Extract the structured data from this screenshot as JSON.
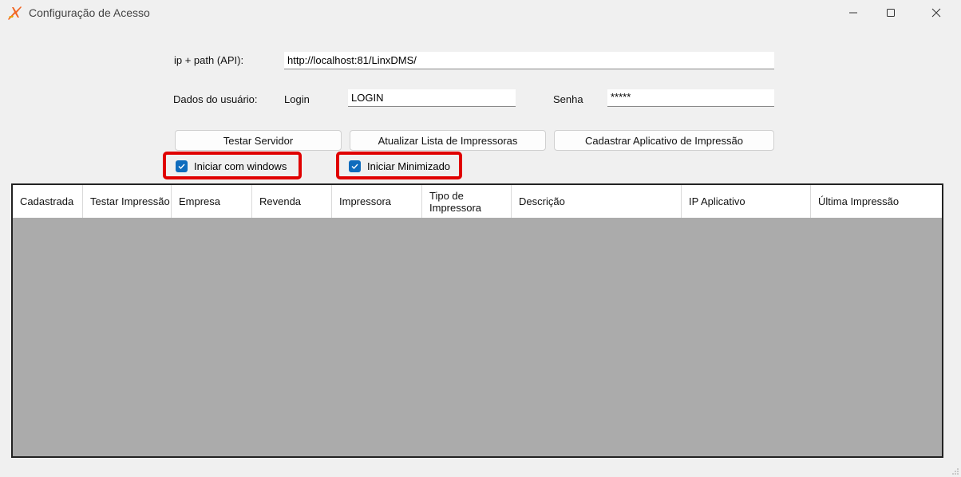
{
  "window": {
    "title": "Configuração de Acesso",
    "controls": {
      "minimize": "minimize-icon",
      "maximize": "maximize-icon",
      "close": "close-icon"
    }
  },
  "form": {
    "api_label": "ip + path (API):",
    "api_value": "http://localhost:81/LinxDMS/",
    "user_label": "Dados do usuário:",
    "login_label": "Login",
    "login_value": "LOGIN",
    "password_label": "Senha",
    "password_value": "*****"
  },
  "buttons": {
    "test_server": "Testar Servidor",
    "update_printers": "Atualizar Lista de Impressoras",
    "register_app": "Cadastrar Aplicativo de Impressão"
  },
  "checkboxes": {
    "start_with_windows": {
      "label": "Iniciar com windows",
      "checked": true
    },
    "start_minimized": {
      "label": "Iniciar Minimizado",
      "checked": true
    }
  },
  "grid": {
    "columns": [
      "Cadastrada",
      "Testar Impressão",
      "Empresa",
      "Revenda",
      "Impressora",
      "Tipo de Impressora",
      "Descrição",
      "IP Aplicativo",
      "Última Impressão"
    ],
    "rows": []
  },
  "colors": {
    "accent": "#0f6cbd",
    "highlight": "#e00000",
    "grid_background": "#ababab",
    "window_background": "#f0f0f0"
  }
}
